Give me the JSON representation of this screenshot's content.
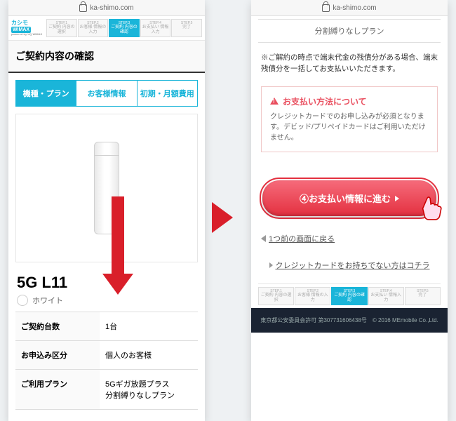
{
  "url": "ka-shimo.com",
  "logo": {
    "brand": "カシモ",
    "product": "WiMAX",
    "sub": "powered by UQ WiMAX"
  },
  "steps": [
    {
      "n": "STEP.1",
      "t": "ご契約\n内容の選択"
    },
    {
      "n": "STEP.2",
      "t": "お客様\n情報の入力"
    },
    {
      "n": "STEP.3",
      "t": "ご契約\n内容の確認"
    },
    {
      "n": "STEP.4",
      "t": "お支払い\n情報入力"
    },
    {
      "n": "STEP.5",
      "t": "完了"
    }
  ],
  "page_title": "ご契約内容の確認",
  "tabs": [
    "機種・プラン",
    "お客様情報",
    "初期・月額費用"
  ],
  "product": {
    "name": "5G L11",
    "color": "ホワイト"
  },
  "table": {
    "qty_k": "ご契約台数",
    "qty_v": "1台",
    "type_k": "お申込み区分",
    "type_v": "個人のお客様",
    "plan_k": "ご利用プラン",
    "plan_v": "5Gギガ放題プラス\n分割縛りなしプラン"
  },
  "right": {
    "plan_top": "分割縛りなしプラン",
    "note": "※ご解約の時点で端末代金の残債分がある場合、端末残債分を一括してお支払いいただきます。",
    "warn_title": "お支払い方法について",
    "warn_body": "クレジットカードでのお申し込みが必須となります。デビッド/プリペイドカードはご利用いただけません。",
    "button": "④お支払い情報に進む",
    "back": "1つ前の画面に戻る",
    "cc_link": "クレジットカードをお持ちでない方はコチラ",
    "footer": "東京都公安委員会許可 第307731606438号　© 2016 MEmobile Co.,Ltd."
  }
}
